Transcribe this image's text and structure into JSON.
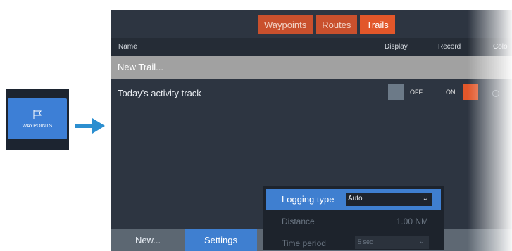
{
  "thumb": {
    "label": "WAYPOINTS",
    "icon": "flag-icon"
  },
  "tabs": [
    {
      "label": "Waypoints",
      "active": false
    },
    {
      "label": "Routes",
      "active": false
    },
    {
      "label": "Trails",
      "active": true
    }
  ],
  "columns": {
    "name": "Name",
    "display": "Display",
    "record": "Record",
    "color": "Colo"
  },
  "rows": {
    "new_trail": "New Trail...",
    "track": {
      "name": "Today's activity track",
      "display_state": "OFF",
      "record_state": "ON"
    }
  },
  "bottom": {
    "new_label": "New...",
    "settings_label": "Settings"
  },
  "popup": {
    "logging_type_label": "Logging type",
    "logging_type_value": "Auto",
    "distance_label": "Distance",
    "distance_value": "1.00 NM",
    "time_period_label": "Time period",
    "time_period_value": "5 sec"
  },
  "colors": {
    "accent_orange": "#e2572a",
    "accent_blue": "#3f7fd0",
    "background": "#2d3541"
  }
}
